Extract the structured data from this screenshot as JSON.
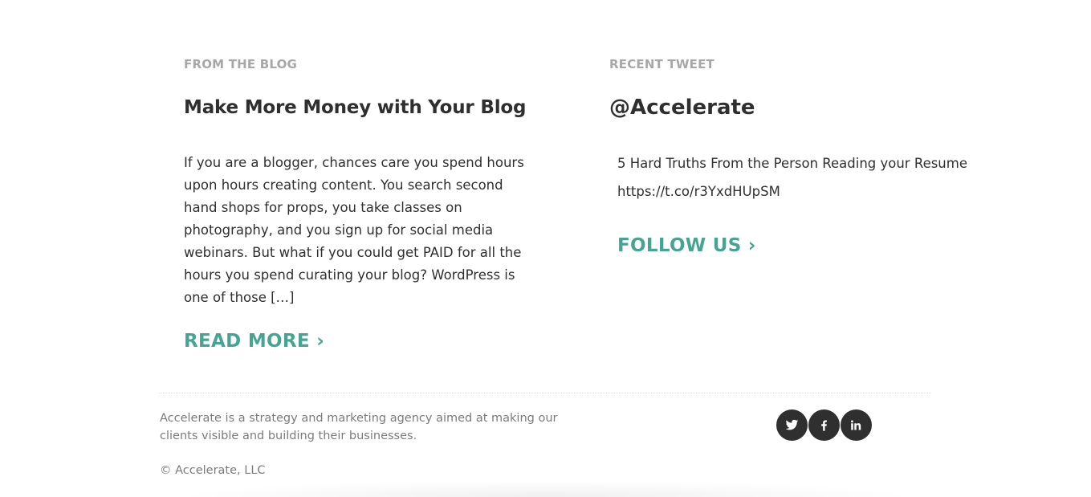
{
  "blog": {
    "eyebrow": "FROM THE BLOG",
    "title": "Make More Money with Your Blog",
    "excerpt_lines": [
      "If you are a blogger, chances care you spend hours",
      "upon hours creating content. You search second",
      "hand shops for props, you take classes on",
      "photography, and you sign up for social media",
      "webinars. But what if you could get PAID for all the",
      "hours you spend curating your blog? WordPress is",
      "one of those […]"
    ],
    "read_more": "READ MORE ›"
  },
  "tweet": {
    "eyebrow": "RECENT TWEET",
    "handle": "@Accelerate",
    "text_lines": [
      "5 Hard Truths From the Person Reading your Resume",
      "https://t.co/r3YxdHUpSM"
    ],
    "follow": "FOLLOW US ›"
  },
  "footer": {
    "about_lines": [
      "Accelerate is a strategy and marketing agency aimed at making our",
      "clients visible and building their businesses."
    ],
    "copyright": "© Accelerate, LLC",
    "social": [
      {
        "icon": "twitter-icon"
      },
      {
        "icon": "facebook-icon"
      },
      {
        "icon": "linkedin-icon"
      }
    ]
  },
  "colors": {
    "accent": "#47a493",
    "heading": "#2f2f2f",
    "muted": "#a7a7a7",
    "footer_text": "#7b7b7b",
    "social_bg": "#2f2f2f"
  }
}
